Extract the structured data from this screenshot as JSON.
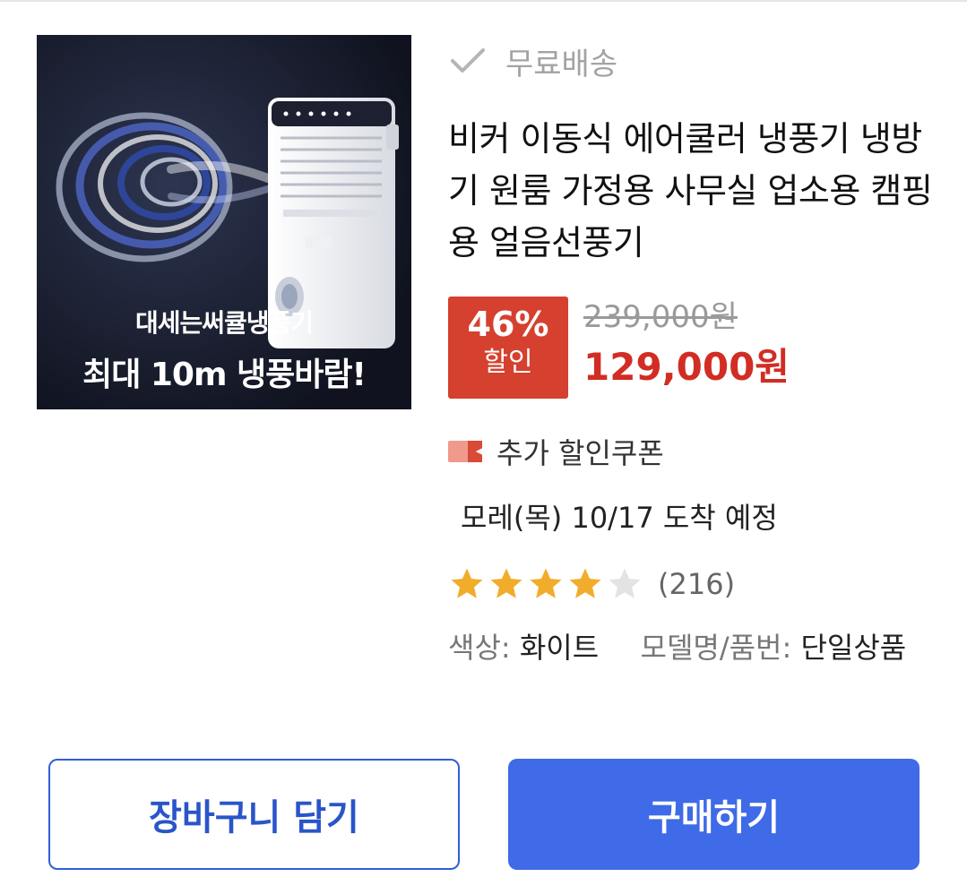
{
  "product": {
    "image_caption_line1": "대세는써큘냉풍기",
    "image_caption_line2": "최대 10m 냉풍바람!",
    "shipping_label": "무료배송",
    "title": "비커 이동식 에어쿨러 냉풍기 냉방기 원룸 가정용 사무실 업소용 캠핑용 얼음선풍기",
    "discount_percent": "46%",
    "discount_label": "할인",
    "original_price": "239,000원",
    "sale_price": "129,000원",
    "coupon_label": "추가 할인쿠폰",
    "arrival_text": "모레(목) 10/17 도착 예정",
    "rating": 4,
    "rating_max": 5,
    "review_count": "(216)",
    "options": {
      "color_key": "색상:",
      "color_value": "화이트",
      "model_key": "모델명/품번:",
      "model_value": "단일상품"
    }
  },
  "actions": {
    "cart_label": "장바구니 담기",
    "buy_label": "구매하기"
  },
  "colors": {
    "discount_red": "#d6402e",
    "price_red": "#d12d24",
    "primary_blue": "#3f6ae8",
    "star_filled": "#f2ac2b",
    "star_empty": "#e3e3e3"
  },
  "icons": {
    "shipping": "check-icon",
    "coupon": "coupon-icon",
    "rating": "star-icon"
  }
}
